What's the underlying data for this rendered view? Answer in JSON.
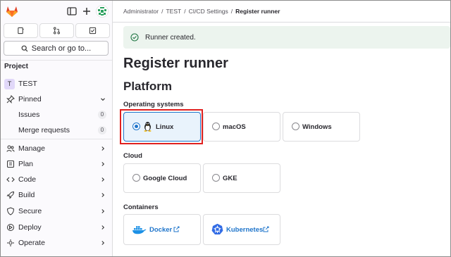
{
  "sidebar": {
    "search_label": "Search or go to...",
    "section_title": "Project",
    "project": {
      "avatar_letter": "T",
      "name": "TEST"
    },
    "pinned": {
      "label": "Pinned",
      "items": [
        {
          "label": "Issues",
          "count": "0"
        },
        {
          "label": "Merge requests",
          "count": "0"
        }
      ]
    },
    "nav": [
      {
        "label": "Manage",
        "icon": "users-icon"
      },
      {
        "label": "Plan",
        "icon": "plan-icon"
      },
      {
        "label": "Code",
        "icon": "code-icon"
      },
      {
        "label": "Build",
        "icon": "rocket-icon"
      },
      {
        "label": "Secure",
        "icon": "shield-icon"
      },
      {
        "label": "Deploy",
        "icon": "deploy-icon"
      },
      {
        "label": "Operate",
        "icon": "operate-icon"
      }
    ]
  },
  "breadcrumb": [
    "Administrator",
    "TEST",
    "CI/CD Settings",
    "Register runner"
  ],
  "alert": {
    "text": "Runner created."
  },
  "page": {
    "title": "Register runner",
    "subtitle": "Platform"
  },
  "groups": {
    "os": {
      "title": "Operating systems",
      "options": [
        {
          "label": "Linux",
          "selected": true
        },
        {
          "label": "macOS",
          "selected": false
        },
        {
          "label": "Windows",
          "selected": false
        }
      ]
    },
    "cloud": {
      "title": "Cloud",
      "options": [
        {
          "label": "Google Cloud",
          "selected": false
        },
        {
          "label": "GKE",
          "selected": false
        }
      ]
    },
    "containers": {
      "title": "Containers",
      "options": [
        {
          "label": "Docker"
        },
        {
          "label": "Kubernetes"
        }
      ]
    }
  },
  "colors": {
    "accent": "#1f75cb",
    "highlight": "#e0201f",
    "success_bg": "#ecf4ee",
    "gitlab_orange": "#e24329"
  }
}
